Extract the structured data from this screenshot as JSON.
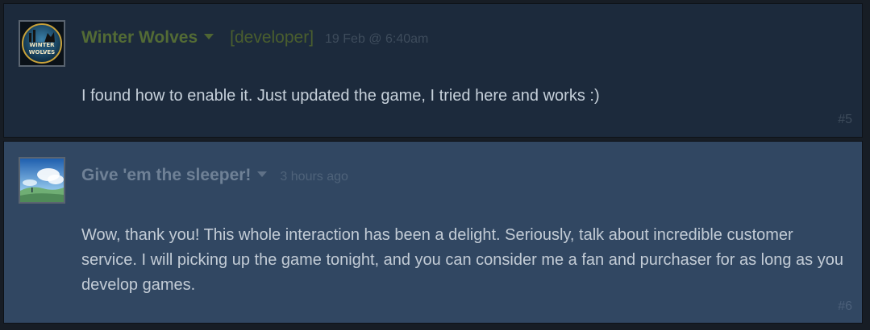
{
  "posts": [
    {
      "author": "Winter Wolves",
      "badge": "[developer]",
      "timestamp": "19 Feb @ 6:40am",
      "message": "I found how to enable it. Just updated the game, I tried here and works :)",
      "post_number": "#5",
      "avatar_text": "WINTER WOLVES",
      "avatar_icon": "winter-wolves-logo-avatar"
    },
    {
      "author": "Give 'em the sleeper!",
      "timestamp": "3 hours ago",
      "message": "Wow, thank you! This whole interaction has been a delight. Seriously, talk about incredible customer service. I will picking up the game tonight, and you can consider me a fan and purchaser for as long as you develop games.",
      "post_number": "#6",
      "avatar_icon": "landscape-sky-avatar"
    }
  ],
  "colors": {
    "developer_post_bg": "#1c2a3c",
    "user_post_bg": "#314762",
    "developer_name": "#536b35",
    "user_name": "#6f8196"
  }
}
